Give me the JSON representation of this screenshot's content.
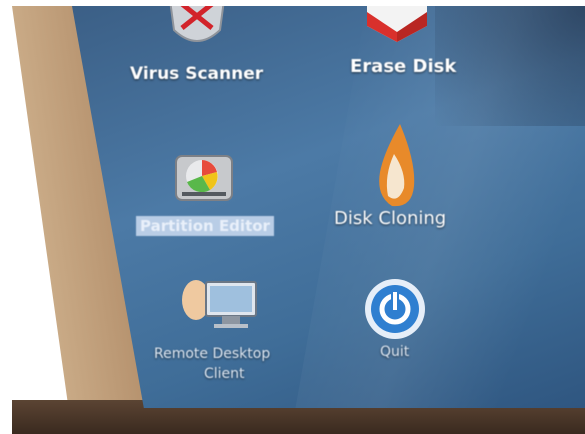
{
  "apps": [
    {
      "label": "Virus Scanner",
      "icon": "virus-scanner-icon"
    },
    {
      "label": "Erase Disk",
      "icon": "erase-disk-icon"
    },
    {
      "label": "Partition Editor",
      "icon": "partition-editor-icon",
      "selected": true
    },
    {
      "label": "Disk Cloning",
      "icon": "disk-cloning-icon"
    },
    {
      "label": "Remote Desktop",
      "label2": "Client",
      "icon": "remote-desktop-client-icon"
    },
    {
      "label": "Quit",
      "icon": "quit-power-icon"
    }
  ],
  "colors": {
    "desktop": "#4c7aa6",
    "selection": "#b9cde6",
    "quit_ring": "#2f7fd0",
    "cloning_flame": "#e88a2a"
  }
}
